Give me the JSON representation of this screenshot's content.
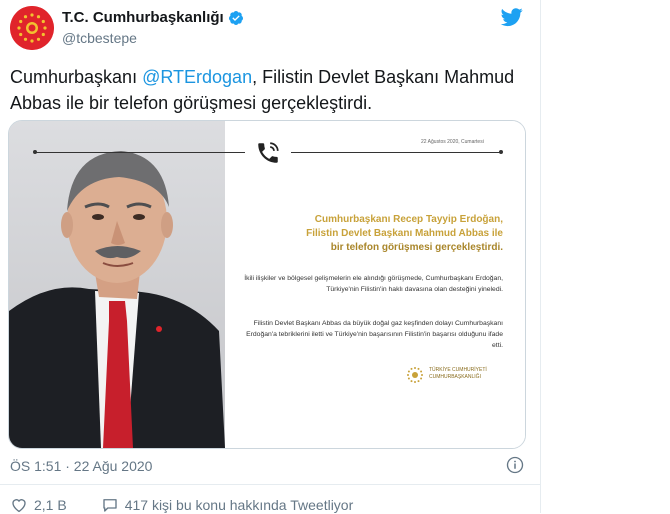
{
  "author": {
    "display_name": "T.C. Cumhurbaşkanlığı",
    "handle": "@tcbestepe"
  },
  "tweet": {
    "text_before": "Cumhurbaşkanı ",
    "mention": "@RTErdogan",
    "text_after": ", Filistin Devlet Başkanı Mahmud Abbas ile bir telefon görüşmesi gerçekleştirdi."
  },
  "card": {
    "date": "22 Ağustos 2020, Cumartesi",
    "headline_1": "Cumhurbaşkanı Recep Tayyip Erdoğan,",
    "headline_2": "Filistin Devlet Başkanı Mahmud Abbas ile",
    "headline_3": "bir telefon görüşmesi gerçekleştirdi.",
    "paragraph_1": "İkili ilişkiler ve bölgesel gelişmelerin ele alındığı görüşmede, Cumhurbaşkanı Erdoğan, Türkiye'nin Filistin'in haklı davasına olan desteğini yineledi.",
    "paragraph_2": "Filistin Devlet Başkanı Abbas da büyük doğal gaz keşfinden dolayı Cumhurbaşkanı Erdoğan'a tebriklerini iletti ve Türkiye'nin başarısının Filistin'in başarısı olduğunu ifade etti.",
    "seal_line_1": "TÜRKİYE CUMHURİYETİ",
    "seal_line_2": "CUMHURBAŞKANLIĞI"
  },
  "meta": {
    "timestamp": "ÖS 1:51 · 22 Ağu 2020"
  },
  "actions": {
    "likes": "2,1 B",
    "comments_text": "417 kişi bu konu hakkında Tweetliyor"
  },
  "colors": {
    "link": "#1b95e0",
    "secondary_text": "#657786",
    "gold": "#c8a23a",
    "brand_red": "#e0242b"
  }
}
